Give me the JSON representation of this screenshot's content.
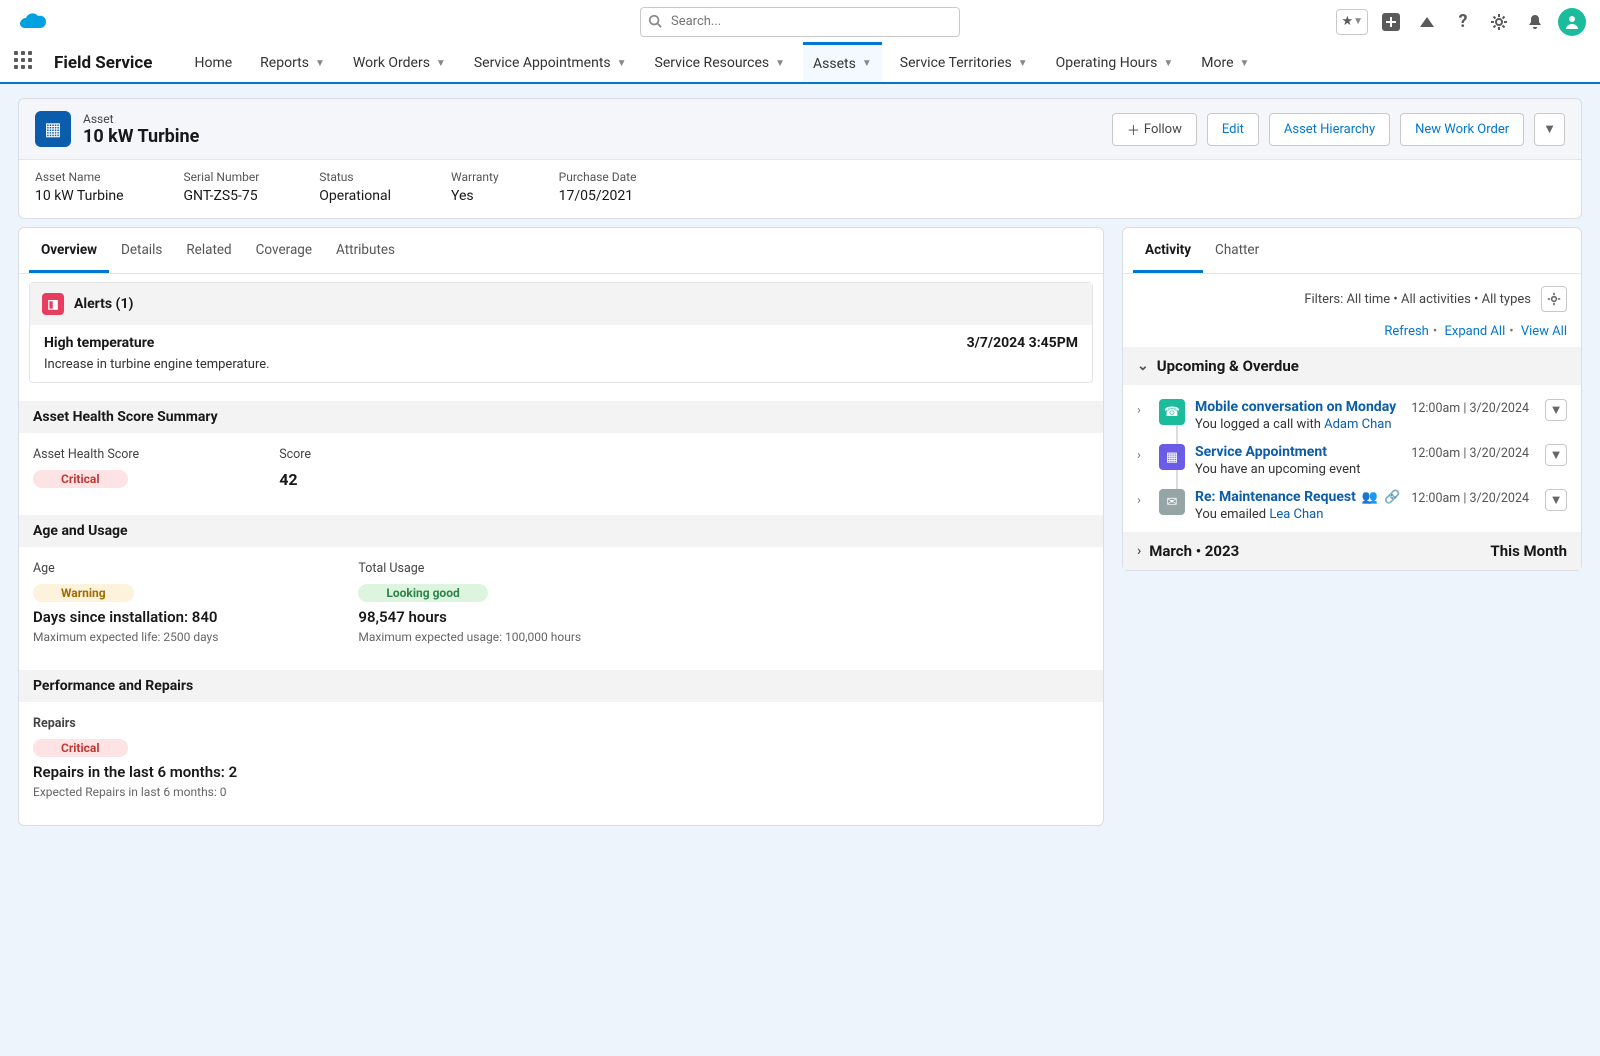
{
  "topbar": {
    "search_placeholder": "Search..."
  },
  "nav": {
    "app_name": "Field Service",
    "items": [
      "Home",
      "Reports",
      "Work Orders",
      "Service Appointments",
      "Service Resources",
      "Assets",
      "Service Territories",
      "Operating Hours",
      "More"
    ]
  },
  "record": {
    "object_type": "Asset",
    "name": "10 kW Turbine",
    "actions": {
      "follow": "Follow",
      "edit": "Edit",
      "hierarchy": "Asset Hierarchy",
      "new_wo": "New Work Order"
    },
    "fields": {
      "asset_name": {
        "label": "Asset Name",
        "value": "10 kW Turbine"
      },
      "serial": {
        "label": "Serial Number",
        "value": "GNT-ZS5-75"
      },
      "status": {
        "label": "Status",
        "value": "Operational"
      },
      "warranty": {
        "label": "Warranty",
        "value": "Yes"
      },
      "purchase": {
        "label": "Purchase Date",
        "value": "17/05/2021"
      }
    }
  },
  "tabs": [
    "Overview",
    "Details",
    "Related",
    "Coverage",
    "Attributes"
  ],
  "alerts": {
    "header": "Alerts (1)",
    "title": "High temperature",
    "timestamp": "3/7/2024 3:45PM",
    "desc": "Increase in turbine engine temperature."
  },
  "health": {
    "header": "Asset Health Score Summary",
    "score_label": "Asset Health Score",
    "score_pill": "Critical",
    "score_col_label": "Score",
    "score_value": "42"
  },
  "age_usage": {
    "header": "Age and Usage",
    "age_label": "Age",
    "age_pill": "Warning",
    "age_text": "Days since installation: 840",
    "age_note": "Maximum expected life: 2500 days",
    "usage_label": "Total Usage",
    "usage_pill": "Looking good",
    "usage_text": "98,547 hours",
    "usage_note": "Maximum expected usage: 100,000 hours"
  },
  "repairs": {
    "header": "Performance and Repairs",
    "label": "Repairs",
    "pill": "Critical",
    "text": "Repairs in the last 6 months: 2",
    "note": "Expected Repairs in last 6 months: 0"
  },
  "activity": {
    "tabs": [
      "Activity",
      "Chatter"
    ],
    "filters": "Filters: All time • All activities • All types",
    "links": {
      "refresh": "Refresh",
      "expand": "Expand All",
      "view_all": "View All"
    },
    "upcoming_header": "Upcoming & Overdue",
    "items": [
      {
        "title": "Mobile conversation on Monday",
        "sub_pre": "You logged a call with ",
        "sub_link": "Adam Chan",
        "meta": "12:00am | 3/20/2024",
        "icon": "phone"
      },
      {
        "title": "Service Appointment",
        "sub_pre": "You have an upcoming event",
        "sub_link": "",
        "meta": "12:00am | 3/20/2024",
        "icon": "event"
      },
      {
        "title": "Re: Maintenance Request",
        "sub_pre": "You emailed ",
        "sub_link": "Lea Chan",
        "meta": "12:00am | 3/20/2024",
        "icon": "email",
        "extras": true
      }
    ],
    "month_header": {
      "left": "March •  2023",
      "right": "This Month"
    }
  }
}
